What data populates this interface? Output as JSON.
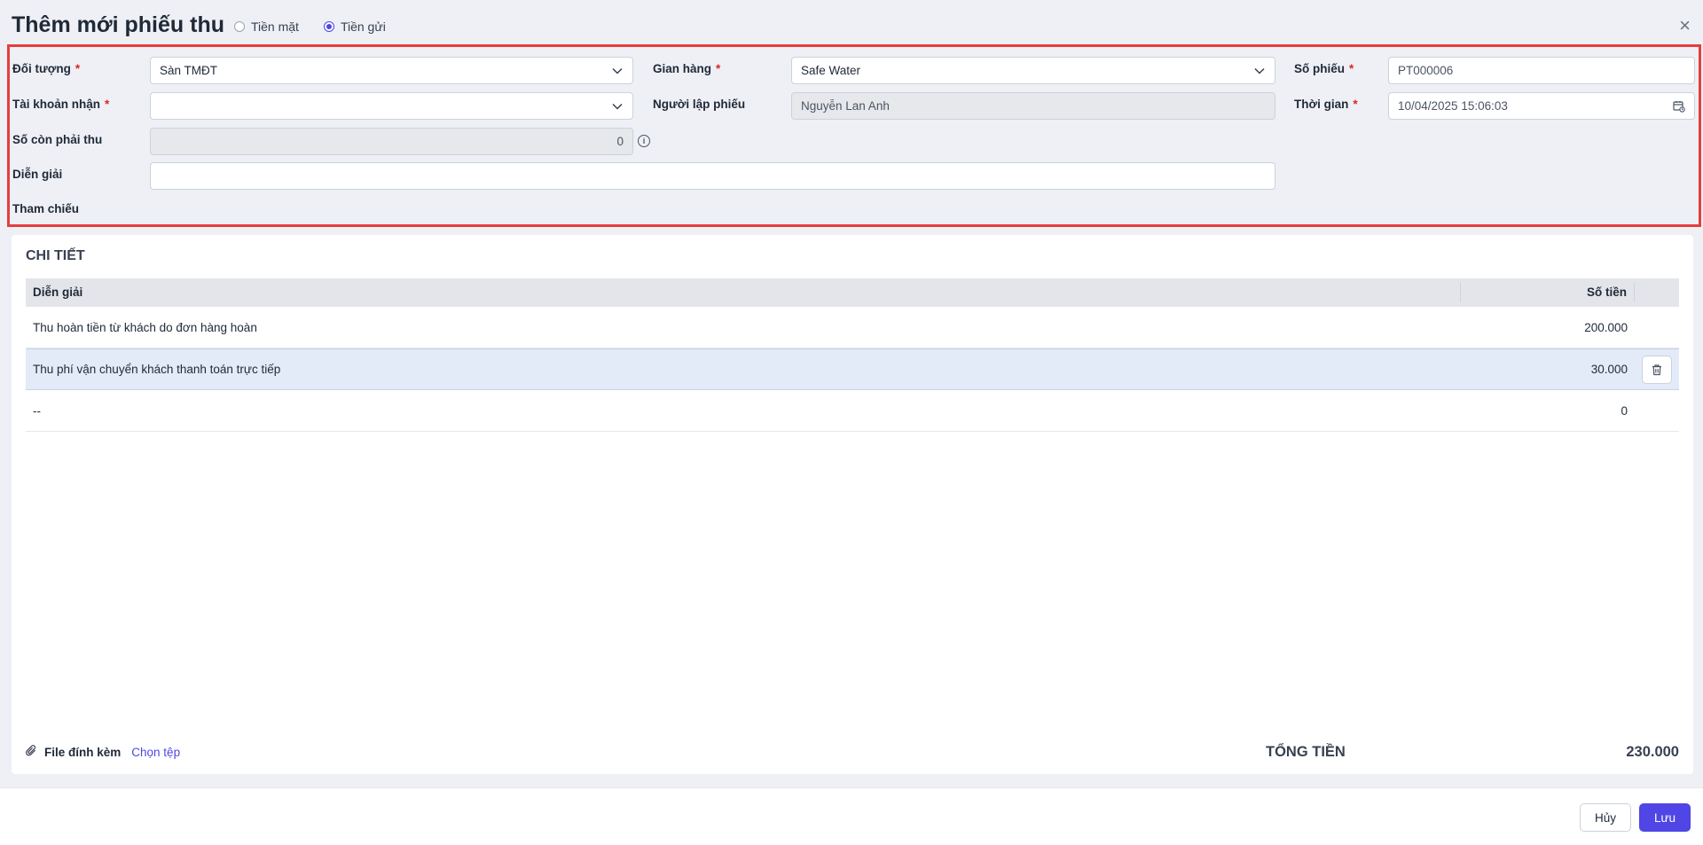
{
  "header": {
    "title": "Thêm mới phiếu thu",
    "payment_options": [
      {
        "label": "Tiền mặt",
        "checked": false
      },
      {
        "label": "Tiền gửi",
        "checked": true
      }
    ],
    "close_glyph": "×"
  },
  "form": {
    "doi_tuong": {
      "label": "Đối tượng",
      "value": "Sàn TMĐT",
      "required": "*"
    },
    "tai_khoan_nhan": {
      "label": "Tài khoản nhận",
      "value": "",
      "required": "*"
    },
    "so_con_phai_thu": {
      "label": "Số còn phải thu",
      "value": "0"
    },
    "dien_giai": {
      "label": "Diễn giải",
      "value": ""
    },
    "tham_chieu": {
      "label": "Tham chiếu"
    },
    "gian_hang": {
      "label": "Gian hàng",
      "value": "Safe Water",
      "required": "*"
    },
    "nguoi_lap_phieu": {
      "label": "Người lập phiếu",
      "value": "Nguyễn Lan Anh"
    },
    "so_phieu": {
      "label": "Số phiếu",
      "value": "PT000006",
      "required": "*"
    },
    "thoi_gian": {
      "label": "Thời gian",
      "value": "10/04/2025 15:06:03",
      "required": "*"
    }
  },
  "detail": {
    "section_title": "CHI TIẾT",
    "columns": [
      "Diễn giải",
      "Số tiền"
    ],
    "rows": [
      {
        "desc": "Thu hoàn tiền từ khách do đơn hàng hoàn",
        "amount": "200.000"
      },
      {
        "desc": "Thu phí vận chuyển khách thanh toán trực tiếp",
        "amount": "30.000"
      },
      {
        "desc": "--",
        "amount": "0"
      }
    ],
    "attachment_label": "File đính kèm",
    "choose_file": "Chọn tệp",
    "total_label": "TỔNG TIỀN",
    "total_value": "230.000"
  },
  "footer": {
    "cancel_label": "Hủy",
    "save_label": "Lưu"
  },
  "colors": {
    "accent": "#4f46e5",
    "highlight_border": "#e53e3e",
    "selected_row": "#e3eaf8"
  }
}
